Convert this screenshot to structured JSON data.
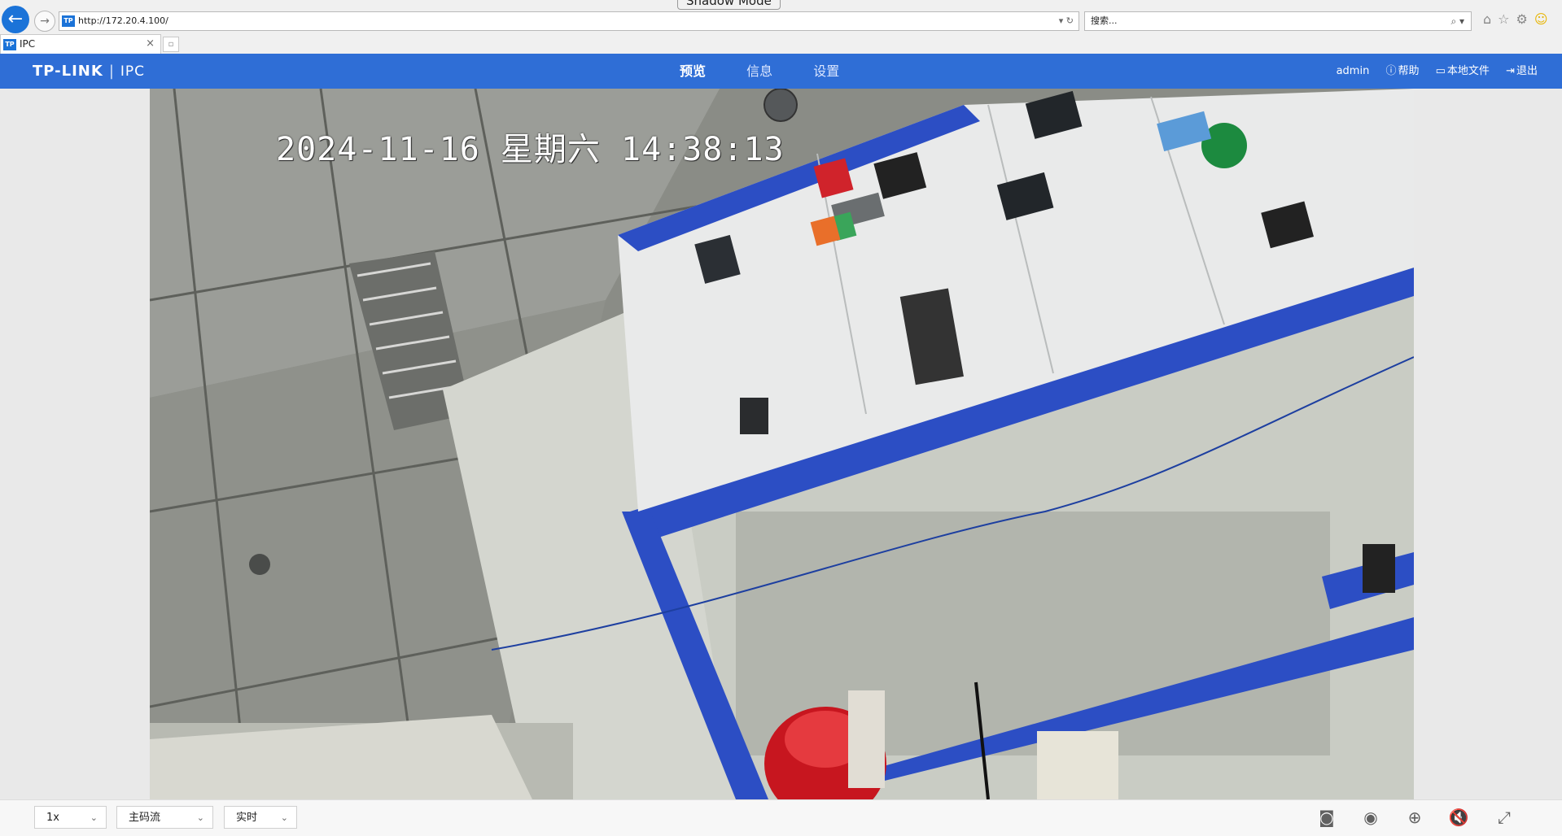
{
  "browser": {
    "shadow_mode_label": "Shadow Mode",
    "back_glyph": "←",
    "forward_glyph": "→",
    "url": "http://172.20.4.100/",
    "favicon_text": "TP",
    "address_tools": "▾ ↻",
    "search_placeholder": "搜索...",
    "search_tools": "⌕ ▾",
    "tab_title": "IPC",
    "tab_close": "×",
    "new_tab_glyph": "▫",
    "icons": [
      "home-icon",
      "star-icon",
      "gear-icon",
      "smiley-icon"
    ]
  },
  "app": {
    "logo": "TP-LINK",
    "logo_sep": "|",
    "product": "IPC",
    "nav": {
      "preview": "预览",
      "info": "信息",
      "settings": "设置"
    },
    "user": "admin",
    "help": "帮助",
    "local_files": "本地文件",
    "logout": "退出",
    "colors": {
      "header": "#2f6ed6",
      "accent": "#1b73d8"
    }
  },
  "video": {
    "osd_timestamp": "2024-11-16 星期六 14:38:13"
  },
  "controls": {
    "speed": "1x",
    "stream": "主码流",
    "mode": "实时",
    "icons": [
      "camera-snapshot-icon",
      "record-icon",
      "zoom-in-icon",
      "mute-icon",
      "fullscreen-icon"
    ]
  }
}
